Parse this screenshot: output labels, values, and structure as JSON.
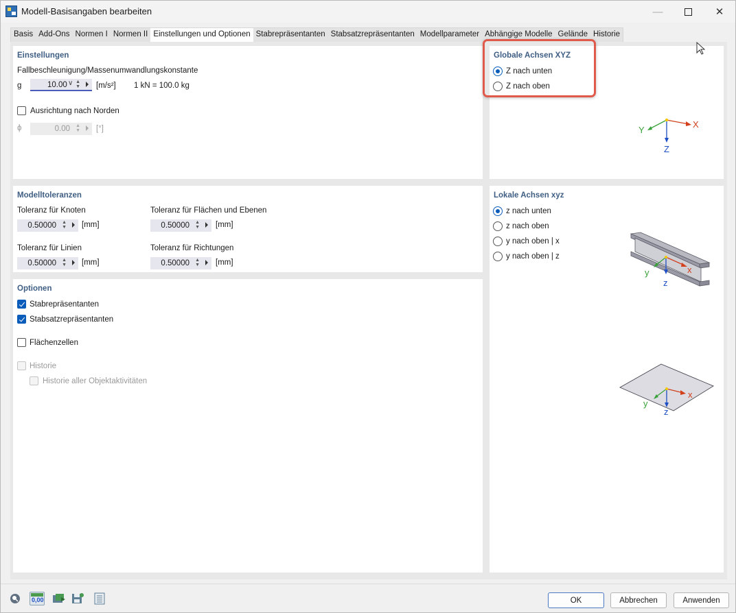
{
  "window": {
    "title": "Modell-Basisangaben bearbeiten"
  },
  "tabs": [
    "Basis",
    "Add-Ons",
    "Normen I",
    "Normen II",
    "Einstellungen und Optionen",
    "Stabrepräsentanten",
    "Stabsatzrepräsentanten",
    "Modellparameter",
    "Abhängige Modelle",
    "Gelände",
    "Historie"
  ],
  "active_tab": "Einstellungen und Optionen",
  "einstellungen": {
    "title": "Einstellungen",
    "gravity_label": "Fallbeschleunigung/Massenumwandlungskonstante",
    "g_symbol": "g",
    "g_value": "10.00",
    "g_unit": "[m/s²]",
    "conversion": "1 kN = 100.0 kg",
    "north_label": "Ausrichtung nach Norden",
    "north_checked": false,
    "phi_symbol": "ϕ",
    "phi_value": "0.00",
    "phi_unit": "[°]"
  },
  "modelltoleranzen": {
    "title": "Modelltoleranzen",
    "knoten_label": "Toleranz für Knoten",
    "knoten_value": "0.50000",
    "flaechen_label": "Toleranz für Flächen und Ebenen",
    "flaechen_value": "0.50000",
    "linien_label": "Toleranz für Linien",
    "linien_value": "0.50000",
    "richtungen_label": "Toleranz für Richtungen",
    "richtungen_value": "0.50000",
    "unit": "[mm]"
  },
  "optionen": {
    "title": "Optionen",
    "stabrep": "Stabrepräsentanten",
    "stabsatzrep": "Stabsatzrepräsentanten",
    "flaechenzellen": "Flächenzellen",
    "historie": "Historie",
    "historie_alle": "Historie aller Objektaktivitäten",
    "stabrep_checked": true,
    "stabsatzrep_checked": true,
    "flaechenzellen_checked": false,
    "historie_checked": false
  },
  "globale_achsen": {
    "title": "Globale Achsen XYZ",
    "option_down": "Z nach unten",
    "option_up": "Z nach oben",
    "selected": "Z nach unten",
    "axis_x": "X",
    "axis_y": "Y",
    "axis_z": "Z"
  },
  "lokale_achsen": {
    "title": "Lokale Achsen xyz",
    "options": [
      "z nach unten",
      "z nach oben",
      "y nach oben | x",
      "y nach oben | z"
    ],
    "selected": "z nach unten",
    "axis_x": "x",
    "axis_y": "y",
    "axis_z": "z"
  },
  "footer": {
    "ok": "OK",
    "cancel": "Abbrechen",
    "apply": "Anwenden",
    "tool_value": "0,00"
  },
  "colors": {
    "accent": "#0a5cba",
    "section_title": "#3f5e83",
    "highlight": "#e05a4c",
    "axis_x": "#d2401c",
    "axis_y": "#3aa23a",
    "axis_z": "#1e4fc4"
  }
}
